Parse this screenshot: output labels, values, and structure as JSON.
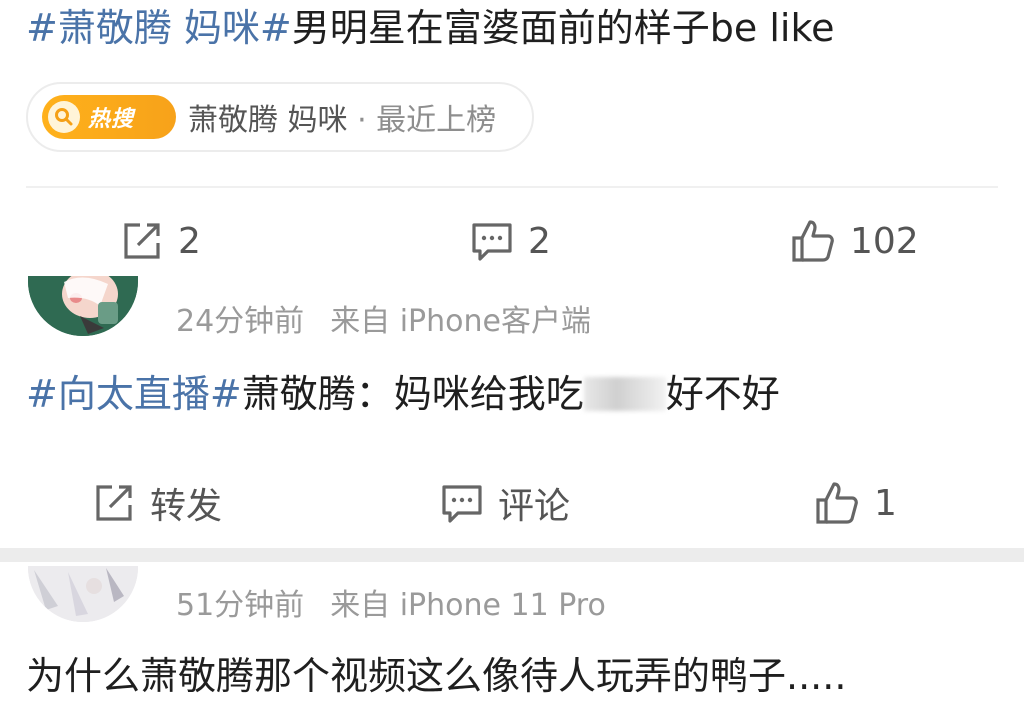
{
  "post": {
    "hashtag1": "#萧敬腾 妈咪#",
    "text": "男明星在富婆面前的样子be like",
    "hot_badge": "热搜",
    "hot_topic": "萧敬腾 妈咪",
    "hot_status": "· 最近上榜",
    "repost_count": "2",
    "comment_count": "2",
    "like_count": "102"
  },
  "comment1": {
    "time": "24分钟前",
    "source": "来自 iPhone客户端",
    "hashtag": "#向太直播#",
    "text_before": "萧敬腾：妈咪给我吃",
    "text_after": "好不好",
    "repost_label": "转发",
    "comment_label": "评论",
    "like_count": "1"
  },
  "comment2": {
    "time": "51分钟前",
    "source": "来自 iPhone 11 Pro",
    "text": "为什么萧敬腾那个视频这么像待人玩弄的鸭子....."
  },
  "icons": {
    "repost": "repost-icon",
    "comment": "comment-icon",
    "like": "thumbs-up-icon",
    "search": "search-icon"
  },
  "colors": {
    "hashtag": "#4a73a8",
    "hot_badge": "#ffb11b",
    "meta_text": "#9a9a9a"
  }
}
